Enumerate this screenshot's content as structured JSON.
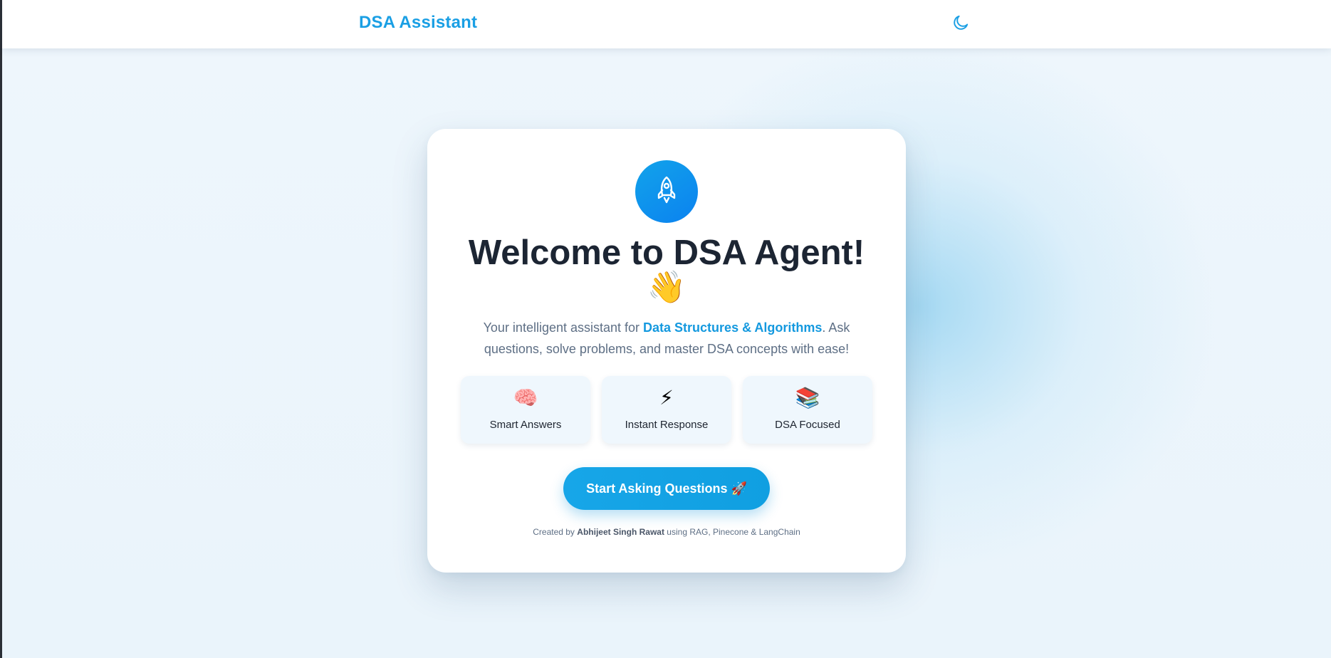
{
  "header": {
    "brand": "DSA Assistant",
    "theme_toggle_icon": "moon-icon"
  },
  "hero": {
    "logo_icon": "rocket-icon",
    "title": "Welcome to DSA Agent!",
    "title_emoji": "👋",
    "subtitle_prefix": "Your intelligent assistant for ",
    "subtitle_highlight": "Data Structures & Algorithms",
    "subtitle_suffix": ". Ask questions, solve problems, and master DSA concepts with ease!"
  },
  "features": [
    {
      "icon": "🧠",
      "icon_name": "brain-icon",
      "label": "Smart Answers"
    },
    {
      "icon": "⚡",
      "icon_name": "lightning-icon",
      "label": "Instant Response"
    },
    {
      "icon": "📚",
      "icon_name": "books-icon",
      "label": "DSA Focused"
    }
  ],
  "cta": {
    "label": "Start Asking Questions 🚀"
  },
  "footer": {
    "prefix": "Created by ",
    "author": "Abhijeet Singh Rawat",
    "suffix": " using RAG, Pinecone & LangChain"
  },
  "colors": {
    "accent": "#1a9fe4",
    "title": "#1c2533",
    "muted": "#5e6f85"
  }
}
